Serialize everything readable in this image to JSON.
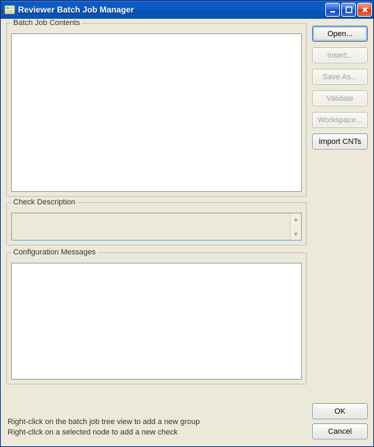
{
  "window": {
    "title": "Reviewer Batch Job Manager"
  },
  "groups": {
    "contents_title": "Batch Job Contents",
    "description_title": "Check Description",
    "messages_title": "Configuration Messages"
  },
  "side_buttons": {
    "open": "Open...",
    "insert": "Insert...",
    "save_as": "Save As...",
    "validate": "Validate",
    "workspace": "Workspace...",
    "import_cnts": "Import CNTs"
  },
  "actions": {
    "ok": "OK",
    "cancel": "Cancel"
  },
  "hints": {
    "line1": "Right-click on the batch job tree view to add a new group",
    "line2": "Right-click on a selected node to add a new check"
  },
  "colors": {
    "titlebar_gradient_top": "#3b8fee",
    "titlebar_gradient_bottom": "#0a52b4",
    "panel_bg": "#ece9d8",
    "border_blue": "#7f9db9"
  }
}
